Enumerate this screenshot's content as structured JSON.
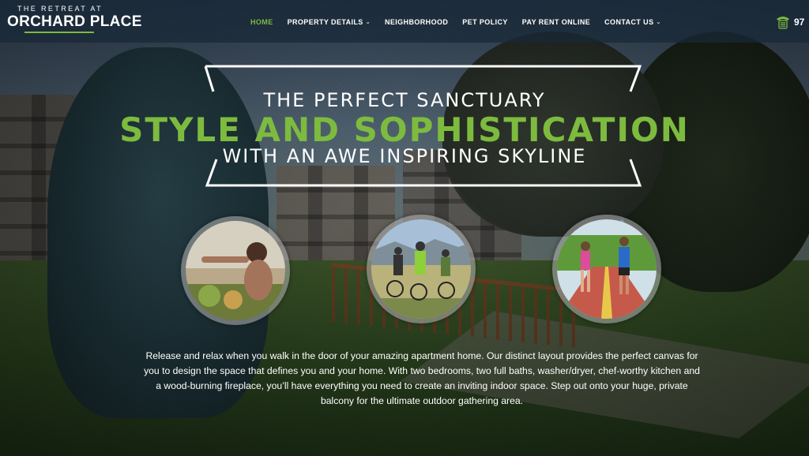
{
  "logo": {
    "top_line": "THE RETREAT AT",
    "main": "ORCHARD PLACE"
  },
  "nav": {
    "items": [
      {
        "label": "HOME",
        "active": true,
        "dropdown": false
      },
      {
        "label": "PROPERTY DETAILS",
        "active": false,
        "dropdown": true
      },
      {
        "label": "NEIGHBORHOOD",
        "active": false,
        "dropdown": false
      },
      {
        "label": "PET POLICY",
        "active": false,
        "dropdown": false
      },
      {
        "label": "PAY RENT ONLINE",
        "active": false,
        "dropdown": false
      },
      {
        "label": "CONTACT US",
        "active": false,
        "dropdown": true
      }
    ],
    "phone_partial": "97"
  },
  "hero": {
    "line1": "THE PERFECT SANCTUARY",
    "line2": "STYLE AND SOPHISTICATION",
    "line3": "WITH AN AWE INSPIRING SKYLINE"
  },
  "description": "Release and relax when you walk in the door of your amazing apartment home. Our distinct layout provides the perfect canvas for you to design the space that defines you and your home. With two bedrooms, two full baths, washer/dryer, chef-worthy kitchen and a wood-burning fireplace, you’ll have everything you need to create an inviting indoor space. Step out onto your huge, private balcony for the ultimate outdoor gathering area.",
  "colors": {
    "accent": "#7dbb3f",
    "nav_bg": "#182838",
    "text": "#ffffff"
  },
  "icons": {
    "phone": "phone-icon"
  }
}
